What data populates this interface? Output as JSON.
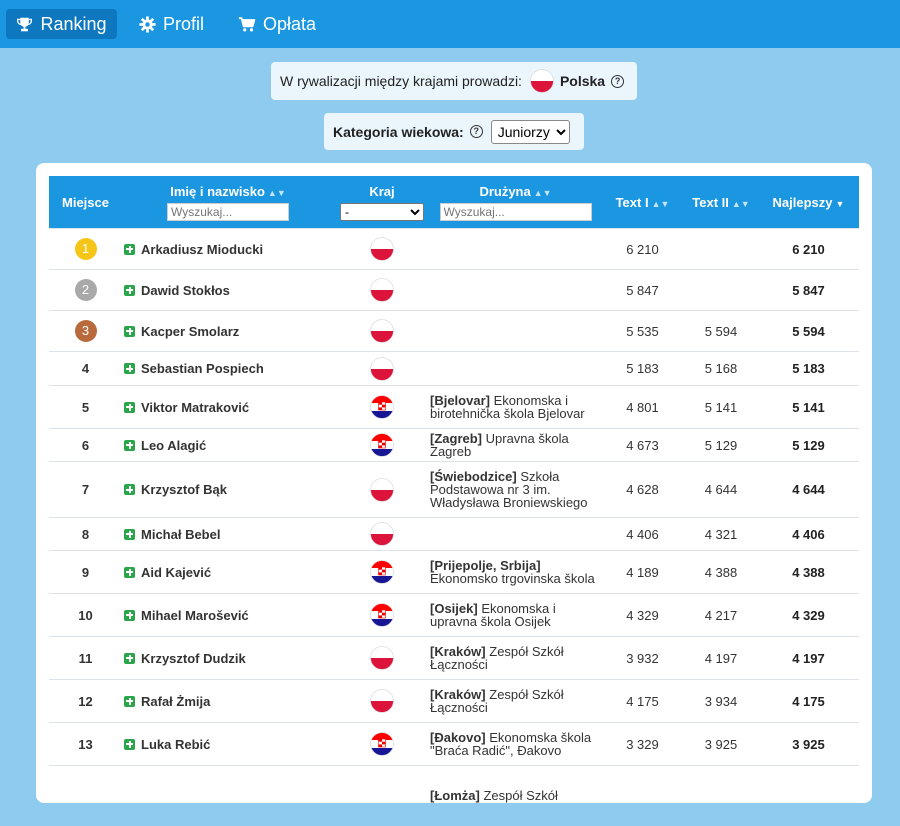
{
  "nav": {
    "items": [
      {
        "label": "Ranking",
        "icon": "trophy-icon",
        "active": true
      },
      {
        "label": "Profil",
        "icon": "gear-icon",
        "active": false
      },
      {
        "label": "Opłata",
        "icon": "cart-icon",
        "active": false
      }
    ]
  },
  "leader": {
    "text": "W rywalizacji między krajami prowadzi:",
    "country": "Polska",
    "icon": "question-circle-icon"
  },
  "category": {
    "label": "Kategoria wiekowa:",
    "selected": "Juniorzy",
    "icon": "question-circle-icon"
  },
  "table": {
    "headers": {
      "place": "Miejsce",
      "name": "Imię i nazwisko",
      "country": "Kraj",
      "team": "Drużyna",
      "text1": "Text I",
      "text2": "Text II",
      "best": "Najlepszy"
    },
    "name_search_placeholder": "Wyszukaj...",
    "team_search_placeholder": "Wyszukaj...",
    "country_filter_selected": "-",
    "rows": [
      {
        "place": "1",
        "name": "Arkadiusz Mioducki",
        "country": "pl",
        "team_city": "",
        "team_name": "",
        "text1": "6 210",
        "text2": "",
        "best": "6 210"
      },
      {
        "place": "2",
        "name": "Dawid Stokłos",
        "country": "pl",
        "team_city": "",
        "team_name": "",
        "text1": "5 847",
        "text2": "",
        "best": "5 847"
      },
      {
        "place": "3",
        "name": "Kacper Smolarz",
        "country": "pl",
        "team_city": "",
        "team_name": "",
        "text1": "5 535",
        "text2": "5 594",
        "best": "5 594"
      },
      {
        "place": "4",
        "name": "Sebastian Pospiech",
        "country": "pl",
        "team_city": "",
        "team_name": "",
        "text1": "5 183",
        "text2": "5 168",
        "best": "5 183"
      },
      {
        "place": "5",
        "name": "Viktor Matraković",
        "country": "hr",
        "team_city": "[Bjelovar]",
        "team_name": "Ekonomska i birotehnička škola Bjelovar",
        "text1": "4 801",
        "text2": "5 141",
        "best": "5 141"
      },
      {
        "place": "6",
        "name": "Leo Alagić",
        "country": "hr",
        "team_city": "[Zagreb]",
        "team_name": "Upravna škola Zagreb",
        "text1": "4 673",
        "text2": "5 129",
        "best": "5 129"
      },
      {
        "place": "7",
        "name": "Krzysztof Bąk",
        "country": "pl",
        "team_city": "[Świebodzice]",
        "team_name": "Szkoła Podstawowa nr 3 im. Władysława Broniewskiego",
        "text1": "4 628",
        "text2": "4 644",
        "best": "4 644"
      },
      {
        "place": "8",
        "name": "Michał Bebel",
        "country": "pl",
        "team_city": "",
        "team_name": "",
        "text1": "4 406",
        "text2": "4 321",
        "best": "4 406"
      },
      {
        "place": "9",
        "name": "Aid Kajević",
        "country": "hr",
        "team_city": "[Prijepolje, Srbija]",
        "team_name": "Ekonomsko trgovinska škola",
        "text1": "4 189",
        "text2": "4 388",
        "best": "4 388"
      },
      {
        "place": "10",
        "name": "Mihael Marošević",
        "country": "hr",
        "team_city": "[Osijek]",
        "team_name": "Ekonomska i upravna škola Osijek",
        "text1": "4 329",
        "text2": "4 217",
        "best": "4 329"
      },
      {
        "place": "11",
        "name": "Krzysztof Dudzik",
        "country": "pl",
        "team_city": "[Kraków]",
        "team_name": "Zespół Szkół Łączności",
        "text1": "3 932",
        "text2": "4 197",
        "best": "4 197"
      },
      {
        "place": "12",
        "name": "Rafał Żmija",
        "country": "pl",
        "team_city": "[Kraków]",
        "team_name": "Zespół Szkół Łączności",
        "text1": "4 175",
        "text2": "3 934",
        "best": "4 175"
      },
      {
        "place": "13",
        "name": "Luka Rebić",
        "country": "hr",
        "team_city": "[Đakovo]",
        "team_name": "Ekonomska škola \"Braća Radić\", Đakovo",
        "text1": "3 329",
        "text2": "3 925",
        "best": "3 925"
      },
      {
        "place": "",
        "name": "",
        "country": "",
        "team_city": "[Łomża]",
        "team_name": "Zespół Szkół",
        "text1": "",
        "text2": "",
        "best": ""
      }
    ]
  },
  "colors": {
    "nav_bg": "#1b96e0",
    "nav_active": "#0d77c0",
    "page_bg": "#8ecbee",
    "header_bg": "#1b96e0",
    "gold": "#f5c518",
    "silver": "#a9a9a9",
    "bronze": "#b86a3c",
    "plus_green": "#2aa64a"
  }
}
